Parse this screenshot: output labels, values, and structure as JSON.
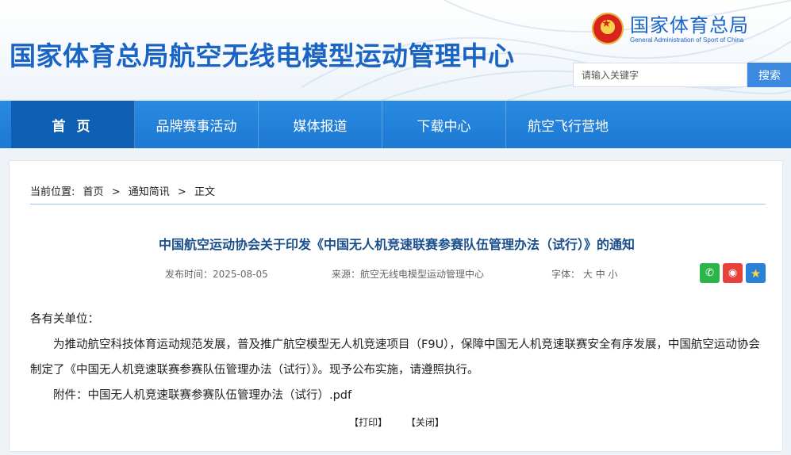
{
  "header": {
    "site_title": "国家体育总局航空无线电模型运动管理中心",
    "logo_cn": "国家体育总局",
    "logo_en": "General Administration of Sport of China",
    "search_placeholder": "请输入关键字",
    "search_button": "搜索"
  },
  "nav": {
    "items": [
      {
        "label": "首 页"
      },
      {
        "label": "品牌赛事活动"
      },
      {
        "label": "媒体报道"
      },
      {
        "label": "下载中心"
      },
      {
        "label": "航空飞行营地"
      }
    ]
  },
  "breadcrumb": {
    "prefix": "当前位置:",
    "home": "首页",
    "sep1": ">",
    "section": "通知简讯",
    "sep2": ">",
    "current": "正文"
  },
  "article": {
    "title": "中国航空运动协会关于印发《中国无人机竞速联赛参赛队伍管理办法（试行）》的通知",
    "publish_time": "发布时间：2025-08-05",
    "source": "来源：航空无线电模型运动管理中心",
    "font_label": "字体：",
    "font_large": "大",
    "font_medium": "中",
    "font_small": "小",
    "salutation": "各有关单位：",
    "paragraph": "为推动航空科技体育运动规范发展，普及推广航空模型无人机竞速项目（F9U），保障中国无人机竞速联赛安全有序发展，中国航空运动协会制定了《中国无人机竞速联赛参赛队伍管理办法（试行）》。现予公布实施，请遵照执行。",
    "attachment": "附件：中国无人机竞速联赛参赛队伍管理办法（试行）.pdf",
    "print": "【打印】",
    "close": "【关闭】"
  },
  "share": {
    "icons": [
      "wechat-icon",
      "weibo-icon",
      "favorite-star-icon"
    ]
  },
  "colors": {
    "brand_blue": "#1a64c4",
    "nav_blue": "#1d79d3",
    "nav_active": "#0f5fb5",
    "title_blue": "#1b4f8c"
  }
}
